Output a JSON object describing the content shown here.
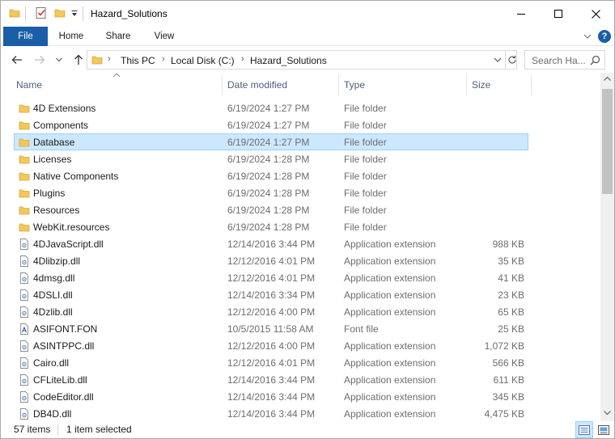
{
  "window": {
    "title": "Hazard_Solutions"
  },
  "ribbon": {
    "tabs": [
      {
        "label": "File"
      },
      {
        "label": "Home"
      },
      {
        "label": "Share"
      },
      {
        "label": "View"
      }
    ],
    "help_label": "?"
  },
  "address": {
    "crumbs": [
      "This PC",
      "Local Disk (C:)",
      "Hazard_Solutions"
    ]
  },
  "search": {
    "placeholder": "Search Ha..."
  },
  "columns": {
    "name": "Name",
    "date": "Date modified",
    "type": "Type",
    "size": "Size"
  },
  "files": [
    {
      "icon": "folder-icon",
      "name": "4D Extensions",
      "date": "6/19/2024 1:27 PM",
      "type": "File folder",
      "size": "",
      "selected": false
    },
    {
      "icon": "folder-icon",
      "name": "Components",
      "date": "6/19/2024 1:27 PM",
      "type": "File folder",
      "size": "",
      "selected": false
    },
    {
      "icon": "folder-icon",
      "name": "Database",
      "date": "6/19/2024 1:27 PM",
      "type": "File folder",
      "size": "",
      "selected": true
    },
    {
      "icon": "folder-icon",
      "name": "Licenses",
      "date": "6/19/2024 1:28 PM",
      "type": "File folder",
      "size": "",
      "selected": false
    },
    {
      "icon": "folder-icon",
      "name": "Native Components",
      "date": "6/19/2024 1:28 PM",
      "type": "File folder",
      "size": "",
      "selected": false
    },
    {
      "icon": "folder-icon",
      "name": "Plugins",
      "date": "6/19/2024 1:28 PM",
      "type": "File folder",
      "size": "",
      "selected": false
    },
    {
      "icon": "folder-icon",
      "name": "Resources",
      "date": "6/19/2024 1:28 PM",
      "type": "File folder",
      "size": "",
      "selected": false
    },
    {
      "icon": "folder-icon",
      "name": "WebKit.resources",
      "date": "6/19/2024 1:28 PM",
      "type": "File folder",
      "size": "",
      "selected": false
    },
    {
      "icon": "dll-icon",
      "name": "4DJavaScript.dll",
      "date": "12/14/2016 3:44 PM",
      "type": "Application extension",
      "size": "988 KB",
      "selected": false
    },
    {
      "icon": "dll-icon",
      "name": "4Dlibzip.dll",
      "date": "12/12/2016 4:01 PM",
      "type": "Application extension",
      "size": "35 KB",
      "selected": false
    },
    {
      "icon": "dll-icon",
      "name": "4dmsg.dll",
      "date": "12/12/2016 4:01 PM",
      "type": "Application extension",
      "size": "41 KB",
      "selected": false
    },
    {
      "icon": "dll-icon",
      "name": "4DSLI.dll",
      "date": "12/14/2016 3:34 PM",
      "type": "Application extension",
      "size": "23 KB",
      "selected": false
    },
    {
      "icon": "dll-icon",
      "name": "4Dzlib.dll",
      "date": "12/12/2016 4:00 PM",
      "type": "Application extension",
      "size": "65 KB",
      "selected": false
    },
    {
      "icon": "font-file-icon",
      "name": "ASIFONT.FON",
      "date": "10/5/2015 11:58 AM",
      "type": "Font file",
      "size": "25 KB",
      "selected": false
    },
    {
      "icon": "dll-icon",
      "name": "ASINTPPC.dll",
      "date": "12/12/2016 4:00 PM",
      "type": "Application extension",
      "size": "1,072 KB",
      "selected": false
    },
    {
      "icon": "dll-icon",
      "name": "Cairo.dll",
      "date": "12/12/2016 4:01 PM",
      "type": "Application extension",
      "size": "566 KB",
      "selected": false
    },
    {
      "icon": "dll-icon",
      "name": "CFLiteLib.dll",
      "date": "12/14/2016 3:44 PM",
      "type": "Application extension",
      "size": "611 KB",
      "selected": false
    },
    {
      "icon": "dll-icon",
      "name": "CodeEditor.dll",
      "date": "12/14/2016 3:44 PM",
      "type": "Application extension",
      "size": "345 KB",
      "selected": false
    },
    {
      "icon": "dll-icon",
      "name": "DB4D.dll",
      "date": "12/14/2016 3:44 PM",
      "type": "Application extension",
      "size": "4,475 KB",
      "selected": false
    }
  ],
  "status": {
    "item_count": "57 items",
    "selection": "1 item selected"
  },
  "colors": {
    "accent": "#1a5ea8",
    "folder": "#f2c75c",
    "selection_bg": "#cce8ff",
    "selection_border": "#99d1ff",
    "secondary_text": "#6d6d6d"
  }
}
